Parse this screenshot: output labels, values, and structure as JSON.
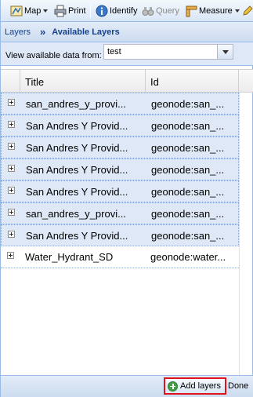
{
  "toolbar": {
    "map_label": "Map",
    "print_label": "Print",
    "identify_label": "Identify",
    "query_label": "Query",
    "measure_label": "Measure"
  },
  "breadcrumb": {
    "parent": "Layers",
    "current": "Available Layers"
  },
  "source": {
    "label": "View available data from:",
    "value": "test"
  },
  "grid": {
    "columns": {
      "title": "Title",
      "id": "Id"
    },
    "rows": [
      {
        "title": "san_andres_y_provi...",
        "id": "geonode:san_...",
        "selected": true
      },
      {
        "title": "San Andres Y Provid...",
        "id": "geonode:san_...",
        "selected": true
      },
      {
        "title": "San Andres Y Provid...",
        "id": "geonode:san_...",
        "selected": true
      },
      {
        "title": "San Andres Y Provid...",
        "id": "geonode:san_...",
        "selected": true
      },
      {
        "title": "San Andres Y Provid...",
        "id": "geonode:san_...",
        "selected": true
      },
      {
        "title": "san_andres_y_provi...",
        "id": "geonode:san_...",
        "selected": true
      },
      {
        "title": "San Andres Y Provid...",
        "id": "geonode:san_...",
        "selected": true
      },
      {
        "title": "Water_Hydrant_SD",
        "id": "geonode:water...",
        "selected": false
      }
    ]
  },
  "footer": {
    "add_label": "Add layers",
    "done_label": "Done"
  },
  "colors": {
    "accent_border": "#99bbe8",
    "highlight": "#e0121b",
    "header_text": "#15428b"
  }
}
